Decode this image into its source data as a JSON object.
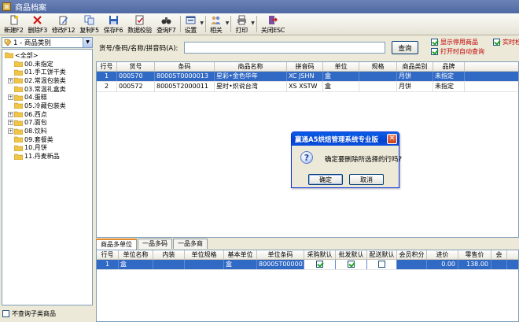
{
  "window": {
    "title": "商品档案"
  },
  "toolbar": {
    "buttons": [
      {
        "label": "新建F2",
        "icon": "new-doc-icon"
      },
      {
        "label": "删除F3",
        "icon": "delete-x-icon"
      },
      {
        "label": "修改F12",
        "icon": "edit-icon"
      },
      {
        "label": "复制F5",
        "icon": "copy-icon"
      },
      {
        "label": "保存F6",
        "icon": "save-icon"
      },
      {
        "label": "数据校验",
        "icon": "check-doc-icon"
      },
      {
        "label": "查询F7",
        "icon": "binoculars-icon"
      },
      {
        "label": "设置",
        "icon": "settings-icon"
      },
      {
        "label": "相关",
        "icon": "people-icon"
      },
      {
        "label": "打印",
        "icon": "printer-icon"
      },
      {
        "label": "关闭ESC",
        "icon": "exit-icon"
      }
    ]
  },
  "category": {
    "selector": "1 - 商品类别",
    "tree": [
      {
        "label": "<全部>",
        "expander": "",
        "level": "root"
      },
      {
        "label": "00.未指定",
        "expander": "",
        "level": "child"
      },
      {
        "label": "01.手工饼干类",
        "expander": "",
        "level": "child"
      },
      {
        "label": "02.常温包装类",
        "expander": "+",
        "level": "child"
      },
      {
        "label": "03.常温礼盒类",
        "expander": "",
        "level": "child"
      },
      {
        "label": "04.蛋糕",
        "expander": "+",
        "level": "child"
      },
      {
        "label": "05.冷藏包装类",
        "expander": "",
        "level": "child"
      },
      {
        "label": "06.西点",
        "expander": "+",
        "level": "child"
      },
      {
        "label": "07.面包",
        "expander": "+",
        "level": "child"
      },
      {
        "label": "08.饮料",
        "expander": "+",
        "level": "child"
      },
      {
        "label": "09.套餐类",
        "expander": "",
        "level": "child"
      },
      {
        "label": "10.月饼",
        "expander": "",
        "level": "child"
      },
      {
        "label": "11.丹麦新品",
        "expander": "",
        "level": "child"
      }
    ],
    "no_sub_label": "不查询子类商品"
  },
  "search": {
    "label": "货号/条码/名称/拼音码(A):",
    "value": "",
    "button": "查询",
    "show_disabled": "显示停用商品",
    "realtime": "实时检索",
    "auto_query": "打开时自动查询"
  },
  "grid": {
    "columns": [
      "行号",
      "货号",
      "条码",
      "商品名称",
      "拼音码",
      "单位",
      "规格",
      "商品类别",
      "品牌"
    ],
    "rows": [
      {
        "seq": "1",
        "code": "000570",
        "barcode": "80005T0000013",
        "name": "星彩•金色华年",
        "pinyin": "XC JSHN",
        "unit": "盒",
        "spec": "",
        "category": "月饼",
        "brand": "未指定",
        "selected": true
      },
      {
        "seq": "2",
        "code": "000572",
        "barcode": "80005T2000011",
        "name": "星时•炽说台湾",
        "pinyin": "XS XSTW",
        "unit": "盒",
        "spec": "",
        "category": "月饼",
        "brand": "未指定",
        "selected": false
      }
    ]
  },
  "tabs": [
    "商品多单位",
    "一品多码",
    "一品多商"
  ],
  "subgrid": {
    "columns": [
      "行号",
      "单位名称",
      "内装",
      "单位规格",
      "基本单位",
      "单位条码",
      "采购默认",
      "批发默认",
      "配送默认",
      "会员积分",
      "进价",
      "零售价",
      "会"
    ],
    "rows": [
      {
        "seq": "1",
        "unit": "盒",
        "inner": "",
        "spec": "",
        "base": "盒",
        "barcode": "80005T0000013",
        "buy": true,
        "wholesale": true,
        "delivery": false,
        "points": "",
        "cost": "0.00",
        "retail": "138.00",
        "extra": ""
      }
    ]
  },
  "dialog": {
    "title": "赢通A5烘焙管理系统专业版",
    "message": "确定要删除所选择的行吗?",
    "ok": "确定",
    "cancel": "取消"
  }
}
